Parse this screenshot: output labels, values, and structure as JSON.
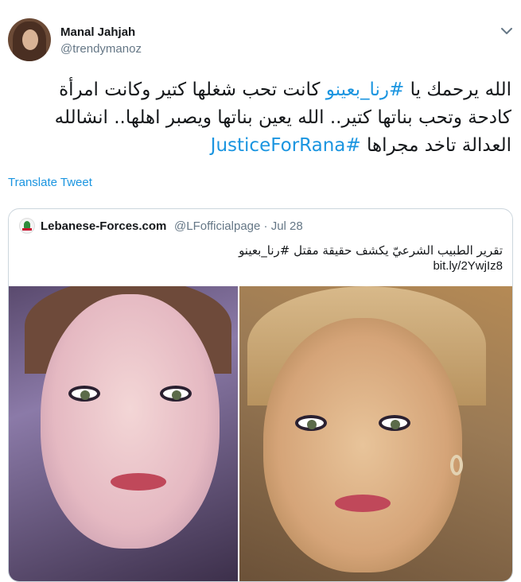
{
  "tweet": {
    "author_name": "Manal Jahjah",
    "author_handle": "@trendymanoz",
    "text_part1": "الله يرحمك يا ",
    "hashtag1": "#رنا_بعينو",
    "text_part2": " كانت تحب شغلها كتير وكانت امرأة كادحة وتحب بناتها كتير.. الله يعين بناتها ويصبر اهلها.. انشالله العدالة تاخد مجراها ",
    "hashtag2": "#JusticeForRana",
    "translate_label": "Translate Tweet"
  },
  "quoted_tweet": {
    "author_name": "Lebanese-Forces.com",
    "author_handle": "@LFofficialpage",
    "date": "· Jul 28",
    "text": "تقرير الطبيب الشرعيّ يكشف حقيقة مقتل #رنا_بعينو",
    "link": "bit.ly/2YwjIz8"
  },
  "icons": {
    "more": "chevron-down-icon",
    "quoted_avatar": "lebanese-forces-logo"
  },
  "colors": {
    "link": "#1b95e0",
    "text": "#14171a",
    "muted": "#657786",
    "border": "#ccd6dd"
  }
}
